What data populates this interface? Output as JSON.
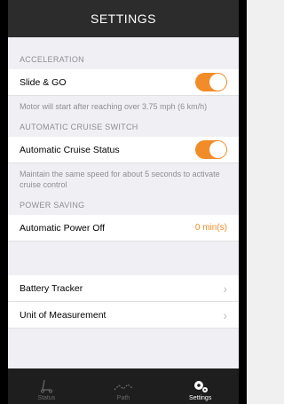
{
  "header": {
    "title": "SETTINGS"
  },
  "sections": {
    "acceleration": {
      "header": "ACCELERATION",
      "row_label": "Slide & GO",
      "toggle_on": true,
      "footnote": "Motor will start after reaching over 3.75 mph (6 km/h)"
    },
    "cruise": {
      "header": "AUTOMATIC CRUISE SWITCH",
      "row_label": "Automatic Cruise Status",
      "toggle_on": true,
      "footnote": "Maintain the same speed for about 5 seconds to activate cruise control"
    },
    "power": {
      "header": "POWER SAVING",
      "row_label": "Automatic Power Off",
      "value": "0 min(s)"
    },
    "more": {
      "battery_label": "Battery Tracker",
      "unit_label": "Unit of Measurement"
    }
  },
  "tabbar": {
    "tabs": [
      {
        "label": "Status",
        "icon": "scooter-icon",
        "active": false
      },
      {
        "label": "Path",
        "icon": "path-icon",
        "active": false
      },
      {
        "label": "Settings",
        "icon": "gears-icon",
        "active": true
      }
    ]
  },
  "colors": {
    "accent": "#f28c28",
    "navbar": "#2c2c2c",
    "tabbar": "#1e1e1e"
  }
}
